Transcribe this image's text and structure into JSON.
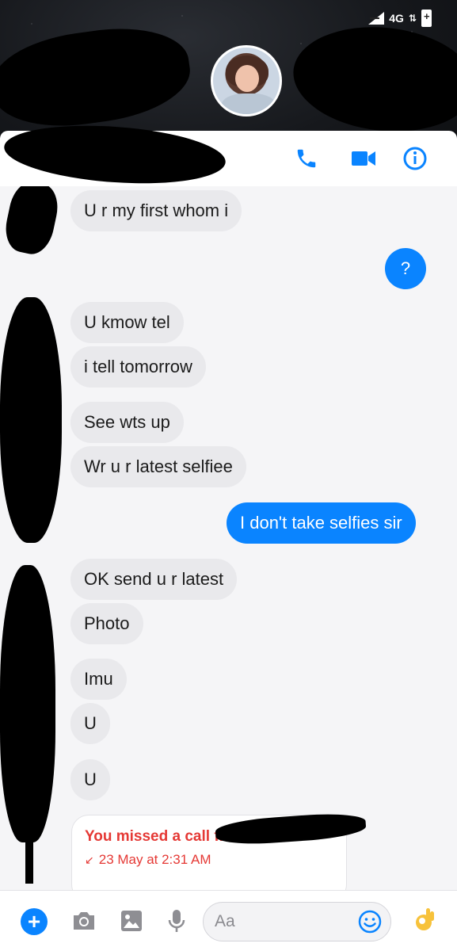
{
  "status_bar": {
    "network": "4G"
  },
  "messages": [
    {
      "dir": "in",
      "text": "U r my first whom i"
    },
    {
      "dir": "out",
      "text": "?"
    },
    {
      "dir": "in",
      "text": "U kmow tel"
    },
    {
      "dir": "in",
      "text": "i tell tomorrow"
    },
    {
      "dir": "in",
      "text": "See wts up"
    },
    {
      "dir": "in",
      "text": "Wr u r latest selfiee"
    },
    {
      "dir": "out",
      "text": "I don't take selfies sir"
    },
    {
      "dir": "in",
      "text": "OK send u r latest"
    },
    {
      "dir": "in",
      "text": "Photo"
    },
    {
      "dir": "in",
      "text": "Imu"
    },
    {
      "dir": "in",
      "text": "U"
    },
    {
      "dir": "in",
      "text": "U"
    }
  ],
  "call_card": {
    "title": "You missed a call fr",
    "time": "23 May at 2:31 AM"
  },
  "composer": {
    "placeholder": "Aa"
  },
  "colors": {
    "accent": "#0a84ff",
    "missed": "#e53935",
    "incoming_bubble": "#e9e9ec"
  }
}
